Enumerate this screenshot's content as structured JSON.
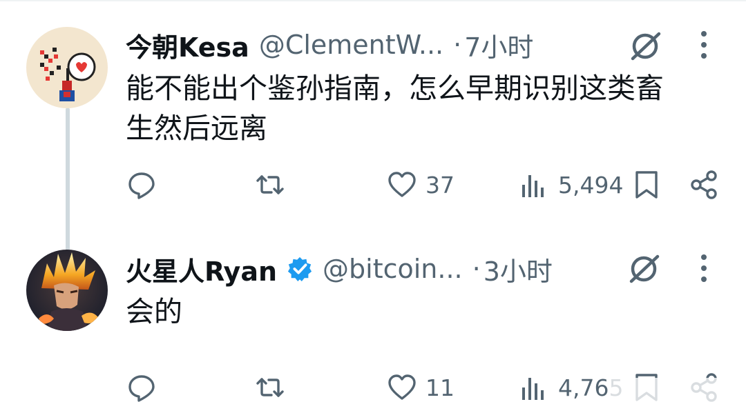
{
  "tweets": [
    {
      "name": "今朝Kesa",
      "handle": "@ClementW...",
      "dot": "·",
      "time": "7小时",
      "text_line1": "能不能出个鉴孙指南，怎么早期识别这类畜",
      "text_line2": "生然后远离",
      "reply_count": "",
      "retweet_count": "",
      "like_count": "37",
      "view_count": "5,494",
      "verified": false
    },
    {
      "name": "火星人Ryan",
      "handle": "@bitcoin...",
      "dot": "·",
      "time": "3小时",
      "text_line1": "会的",
      "text_line2": "",
      "reply_count": "",
      "retweet_count": "",
      "like_count": "11",
      "view_count": "4,765",
      "verified": true
    }
  ],
  "icons": {
    "reply": "reply-icon",
    "retweet": "retweet-icon",
    "like": "heart-icon",
    "views": "views-icon",
    "bookmark": "bookmark-icon",
    "share": "share-icon",
    "grok": "grok-icon",
    "more": "more-icon",
    "verified": "verified-badge-icon"
  },
  "colors": {
    "text": "#0f1419",
    "secondary": "#536471",
    "verified": "#1d9bf0",
    "thread_line": "#cfd9de"
  }
}
